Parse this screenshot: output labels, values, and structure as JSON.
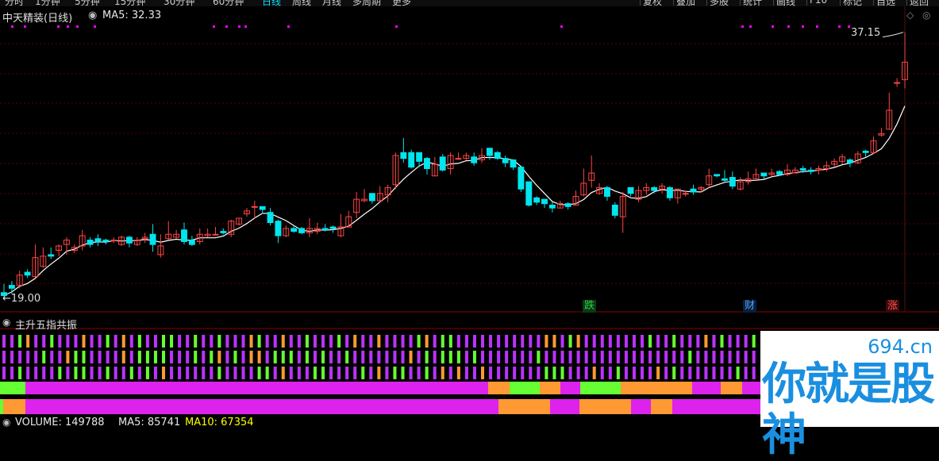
{
  "toolbar": {
    "periods": [
      "分时",
      "1分钟",
      "5分钟",
      "15分钟",
      "30分钟",
      "60分钟",
      "日线",
      "周线",
      "月线",
      "多周期",
      "更多"
    ],
    "active_period": "日线",
    "buttons": [
      "复权",
      "叠加",
      "多股",
      "统计",
      "画线",
      "F10",
      "标记",
      "自选",
      "返回"
    ]
  },
  "main_panel": {
    "title": "中天精装(日线)",
    "ma_label": "MA5: 32.33",
    "high_label": "37.15",
    "low_label": "←19.00",
    "events": [
      {
        "text": "跌",
        "color": "#2ecc40",
        "bg": "#0a3a14"
      },
      {
        "text": "财",
        "color": "#4ea3ff",
        "bg": "#0a1f3a"
      },
      {
        "text": "涨",
        "color": "#ff5050",
        "bg": "#3a0a0a"
      }
    ],
    "colors": {
      "up": "#ff4444",
      "down": "#00e5ee",
      "ma": "#ffffff",
      "grid": "#5a0000",
      "signal": "#ff00ff"
    }
  },
  "indicator_panel": {
    "title": "主升五指共振",
    "colors": {
      "green": "#66ff33",
      "purple": "#bb33ff",
      "orange": "#ff9933",
      "magenta": "#dd22ee"
    }
  },
  "volume_panel": {
    "volume": "VOLUME: 149788",
    "ma5": "MA5: 85741",
    "ma10": "MA10: 67354",
    "colors": {
      "ma5": "#ffffff",
      "ma10": "#ffff00"
    }
  },
  "watermark": {
    "url": "694.cn",
    "text": "你就是股神"
  },
  "chart_data": {
    "type": "candlestick",
    "title": "中天精装(日线)",
    "ma5_last": 32.33,
    "high_marker": 37.15,
    "low_marker": 19.0,
    "candles": [
      [
        19.3,
        19.1,
        18.9,
        19.9
      ],
      [
        19.8,
        19.6,
        19.2,
        20.1
      ],
      [
        19.8,
        20.5,
        19.6,
        20.8
      ],
      [
        20.7,
        20.5,
        20.3,
        20.9
      ],
      [
        20.4,
        21.7,
        20.3,
        22.6
      ],
      [
        21.1,
        21.8,
        21.0,
        22.4
      ],
      [
        21.9,
        21.8,
        21.6,
        22.4
      ],
      [
        22.2,
        22.5,
        21.8,
        22.6
      ],
      [
        22.6,
        22.9,
        21.9,
        23.1
      ],
      [
        22.2,
        22.4,
        22.0,
        22.6
      ],
      [
        22.5,
        23.2,
        22.2,
        23.6
      ],
      [
        22.9,
        22.6,
        22.4,
        23.1
      ],
      [
        23.0,
        22.8,
        22.5,
        23.3
      ],
      [
        22.9,
        22.8,
        22.6,
        23.0
      ],
      [
        22.9,
        22.9,
        22.7,
        23.1
      ],
      [
        22.6,
        23.1,
        22.5,
        23.2
      ],
      [
        23.1,
        22.7,
        22.4,
        23.2
      ],
      [
        22.6,
        22.9,
        22.5,
        23.1
      ],
      [
        23.0,
        23.1,
        22.7,
        23.4
      ],
      [
        23.3,
        22.6,
        22.1,
        24.0
      ],
      [
        21.9,
        22.5,
        21.7,
        23.3
      ],
      [
        23.0,
        23.3,
        22.9,
        24.2
      ],
      [
        23.1,
        23.3,
        23.0,
        23.6
      ],
      [
        23.6,
        22.8,
        22.6,
        24.1
      ],
      [
        22.9,
        22.6,
        22.5,
        23.2
      ],
      [
        22.8,
        23.3,
        22.6,
        23.7
      ],
      [
        23.2,
        23.3,
        23.1,
        23.7
      ],
      [
        23.3,
        23.3,
        23.2,
        23.8
      ],
      [
        23.5,
        23.4,
        23.3,
        23.7
      ],
      [
        23.3,
        24.2,
        23.1,
        24.3
      ],
      [
        24.0,
        24.4,
        23.9,
        24.4
      ],
      [
        24.7,
        24.9,
        24.5,
        25.1
      ],
      [
        25.2,
        25.2,
        24.4,
        25.6
      ],
      [
        25.2,
        25.0,
        24.7,
        25.1
      ],
      [
        24.8,
        24.1,
        23.9,
        25.1
      ],
      [
        24.2,
        23.2,
        22.7,
        24.3
      ],
      [
        23.2,
        23.7,
        23.1,
        23.9
      ],
      [
        23.7,
        23.5,
        23.4,
        23.9
      ],
      [
        23.7,
        23.4,
        23.3,
        23.8
      ],
      [
        23.4,
        23.7,
        23.1,
        24.4
      ],
      [
        23.5,
        23.7,
        23.3,
        24.1
      ],
      [
        23.7,
        23.6,
        23.5,
        24.0
      ],
      [
        23.8,
        23.7,
        23.4,
        23.9
      ],
      [
        23.2,
        23.8,
        23.1,
        24.7
      ],
      [
        23.8,
        24.5,
        23.8,
        24.9
      ],
      [
        24.8,
        25.7,
        24.4,
        26.2
      ],
      [
        25.6,
        25.7,
        25.5,
        26.4
      ],
      [
        26.1,
        25.6,
        25.4,
        25.8
      ],
      [
        25.6,
        26.1,
        25.5,
        26.6
      ],
      [
        26.0,
        26.5,
        25.5,
        26.7
      ],
      [
        26.7,
        28.7,
        26.4,
        28.9
      ],
      [
        28.9,
        28.5,
        28.2,
        29.9
      ],
      [
        28.9,
        27.9,
        27.8,
        29.1
      ],
      [
        28.9,
        28.3,
        27.9,
        28.9
      ],
      [
        28.5,
        27.8,
        27.4,
        28.6
      ],
      [
        27.3,
        28.1,
        27.3,
        28.6
      ],
      [
        28.6,
        27.7,
        27.6,
        28.8
      ],
      [
        27.8,
        28.7,
        27.4,
        28.9
      ],
      [
        28.5,
        28.5,
        28.4,
        28.9
      ],
      [
        28.5,
        28.7,
        28.4,
        28.9
      ],
      [
        28.6,
        28.2,
        28.0,
        28.9
      ],
      [
        28.4,
        28.7,
        28.2,
        29.2
      ],
      [
        29.2,
        28.7,
        28.4,
        29.1
      ],
      [
        28.9,
        28.5,
        28.4,
        29.0
      ],
      [
        28.5,
        28.2,
        27.9,
        28.7
      ],
      [
        28.4,
        27.9,
        27.7,
        28.3
      ],
      [
        27.9,
        26.4,
        26.2,
        27.9
      ],
      [
        26.9,
        25.3,
        25.2,
        26.8
      ],
      [
        25.8,
        25.5,
        25.3,
        25.9
      ],
      [
        25.7,
        25.4,
        25.1,
        25.7
      ],
      [
        25.3,
        25.1,
        24.8,
        25.5
      ],
      [
        25.1,
        25.4,
        25.1,
        25.6
      ],
      [
        25.4,
        25.2,
        25.0,
        25.5
      ],
      [
        25.3,
        25.9,
        25.3,
        26.3
      ],
      [
        26.0,
        26.8,
        25.9,
        27.8
      ],
      [
        27.0,
        27.5,
        26.5,
        28.7
      ],
      [
        26.1,
        26.5,
        26.0,
        26.8
      ],
      [
        26.5,
        25.9,
        25.6,
        26.6
      ],
      [
        25.3,
        24.6,
        24.4,
        25.5
      ],
      [
        24.5,
        25.9,
        23.4,
        26.2
      ],
      [
        26.5,
        26.1,
        25.9,
        26.5
      ],
      [
        25.7,
        26.3,
        25.5,
        26.6
      ],
      [
        26.3,
        26.5,
        26.0,
        26.8
      ],
      [
        26.5,
        26.3,
        26.1,
        26.6
      ],
      [
        26.4,
        26.6,
        26.1,
        26.8
      ],
      [
        26.5,
        25.8,
        25.6,
        26.6
      ],
      [
        25.8,
        26.4,
        25.4,
        26.4
      ],
      [
        26.1,
        26.1,
        25.9,
        26.3
      ],
      [
        26.4,
        26.2,
        26.0,
        26.7
      ],
      [
        26.4,
        26.5,
        26.2,
        26.6
      ],
      [
        26.7,
        27.3,
        26.5,
        27.8
      ],
      [
        27.4,
        27.3,
        27.2,
        27.4
      ],
      [
        27.1,
        27.0,
        26.9,
        27.7
      ],
      [
        27.2,
        26.6,
        26.4,
        27.6
      ],
      [
        26.4,
        26.9,
        26.3,
        27.2
      ],
      [
        26.9,
        27.1,
        26.7,
        27.6
      ],
      [
        27.1,
        27.4,
        27.1,
        27.8
      ],
      [
        27.5,
        27.3,
        27.1,
        27.5
      ],
      [
        27.4,
        27.5,
        27.3,
        27.8
      ],
      [
        27.6,
        27.4,
        27.3,
        27.7
      ],
      [
        27.4,
        27.7,
        27.3,
        28.1
      ],
      [
        27.5,
        27.7,
        27.5,
        27.9
      ],
      [
        27.8,
        27.7,
        27.5,
        28.0
      ],
      [
        27.7,
        27.6,
        27.4,
        27.9
      ],
      [
        27.7,
        27.8,
        27.4,
        28.0
      ],
      [
        27.8,
        28.0,
        27.6,
        28.3
      ],
      [
        28.1,
        28.3,
        27.9,
        28.5
      ],
      [
        28.3,
        28.6,
        28.1,
        28.8
      ],
      [
        28.4,
        28.2,
        27.9,
        28.5
      ],
      [
        28.2,
        28.8,
        28.1,
        29.0
      ],
      [
        29.0,
        28.9,
        28.6,
        29.1
      ],
      [
        28.9,
        29.7,
        28.8,
        30.0
      ],
      [
        30.1,
        30.2,
        30.0,
        30.6
      ],
      [
        30.5,
        31.8,
        30.5,
        33.0
      ],
      [
        33.7,
        33.7,
        33.4,
        34.0
      ],
      [
        33.9,
        35.1,
        33.3,
        37.15
      ]
    ]
  }
}
